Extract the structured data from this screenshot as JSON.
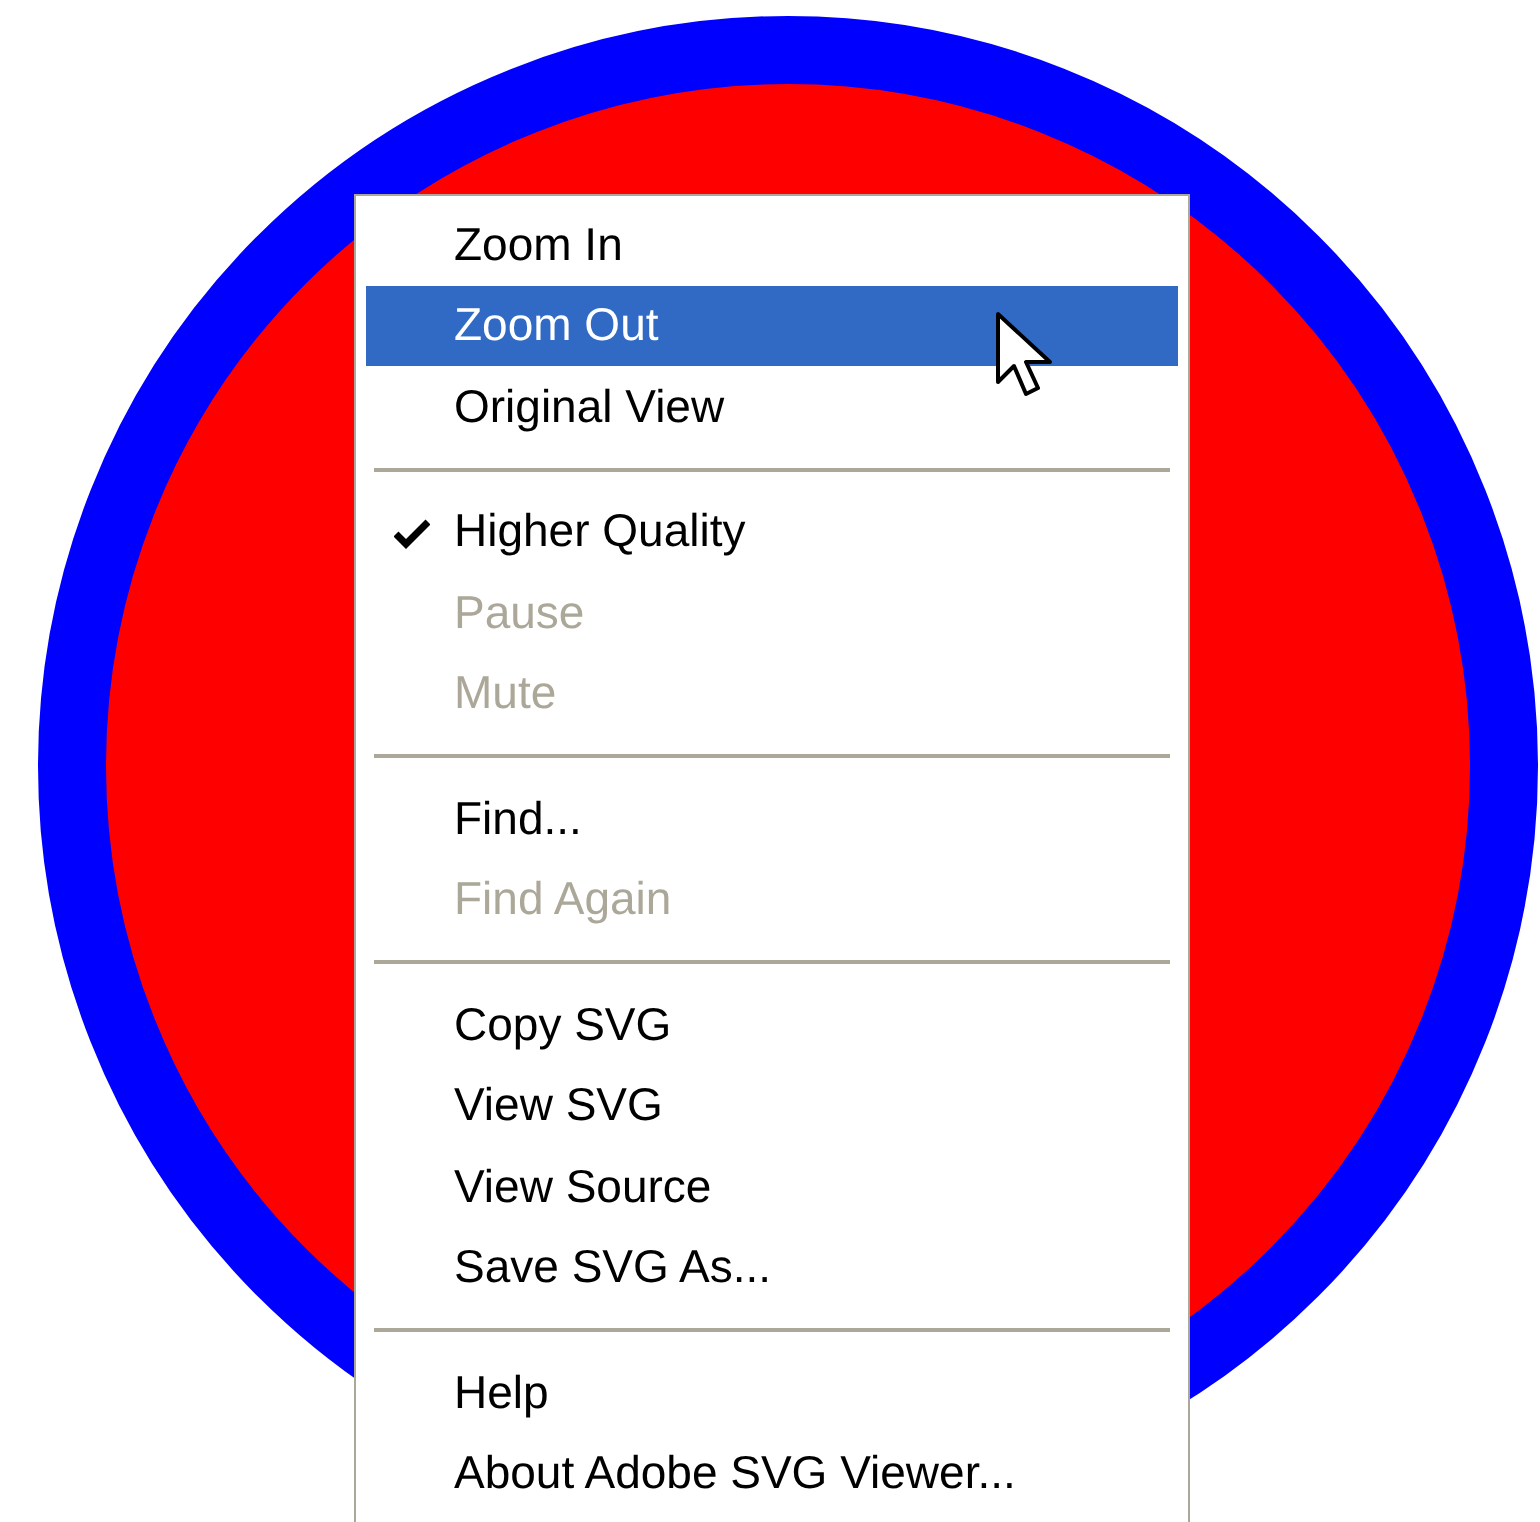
{
  "context_menu": {
    "groups": [
      {
        "items": [
          {
            "label": "Zoom In",
            "selected": false,
            "disabled": false,
            "checked": false
          },
          {
            "label": "Zoom Out",
            "selected": true,
            "disabled": false,
            "checked": false
          },
          {
            "label": "Original View",
            "selected": false,
            "disabled": false,
            "checked": false
          }
        ]
      },
      {
        "items": [
          {
            "label": "Higher Quality",
            "selected": false,
            "disabled": false,
            "checked": true
          },
          {
            "label": "Pause",
            "selected": false,
            "disabled": true,
            "checked": false
          },
          {
            "label": "Mute",
            "selected": false,
            "disabled": true,
            "checked": false
          }
        ]
      },
      {
        "items": [
          {
            "label": "Find...",
            "selected": false,
            "disabled": false,
            "checked": false
          },
          {
            "label": "Find Again",
            "selected": false,
            "disabled": true,
            "checked": false
          }
        ]
      },
      {
        "items": [
          {
            "label": "Copy SVG",
            "selected": false,
            "disabled": false,
            "checked": false
          },
          {
            "label": "View SVG",
            "selected": false,
            "disabled": false,
            "checked": false
          },
          {
            "label": "View Source",
            "selected": false,
            "disabled": false,
            "checked": false
          },
          {
            "label": "Save SVG As...",
            "selected": false,
            "disabled": false,
            "checked": false
          }
        ]
      },
      {
        "items": [
          {
            "label": "Help",
            "selected": false,
            "disabled": false,
            "checked": false
          },
          {
            "label": "About Adobe SVG Viewer...",
            "selected": false,
            "disabled": false,
            "checked": false
          }
        ]
      }
    ]
  }
}
